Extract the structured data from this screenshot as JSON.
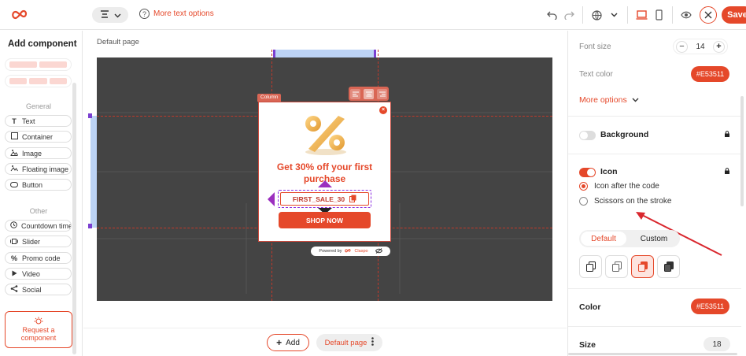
{
  "toolbar": {
    "help_text": "More text options",
    "save_label": "Save"
  },
  "left_panel": {
    "title": "Add component",
    "group_general": "General",
    "group_other": "Other",
    "general_items": [
      "Text",
      "Container",
      "Image",
      "Floating image",
      "Button"
    ],
    "other_items": [
      "Countdown timer",
      "Slider",
      "Promo code",
      "Video",
      "Social"
    ],
    "request_label_1": "Request a",
    "request_label_2": "component"
  },
  "canvas": {
    "page_label": "Default page",
    "column_tag": "Column",
    "popup": {
      "headline_1": "Get 30% off your first",
      "headline_2": "purchase",
      "promo_code": "FIRST_SALE_30",
      "button_label": "SHOP NOW",
      "powered_by": "Powered by",
      "brand": "Claspo"
    }
  },
  "bottom_bar": {
    "add_label": "Add",
    "page_label": "Default page"
  },
  "right_panel": {
    "font_size_label": "Font size",
    "font_size_value": "14",
    "text_color_label": "Text color",
    "text_color_value": "#E53511",
    "more_options": "More options",
    "background_label": "Background",
    "background_enabled": false,
    "icon_label": "Icon",
    "icon_enabled": true,
    "icon_option_1": "Icon after the code",
    "icon_option_2": "Scissors on the stroke",
    "tab_default": "Default",
    "tab_custom": "Custom",
    "color_label": "Color",
    "color_value": "#E53511",
    "size_label": "Size",
    "size_value": "18"
  },
  "colors": {
    "accent": "#E5482A",
    "canvas_bg": "#444444",
    "selection": "#7B3FD1"
  }
}
